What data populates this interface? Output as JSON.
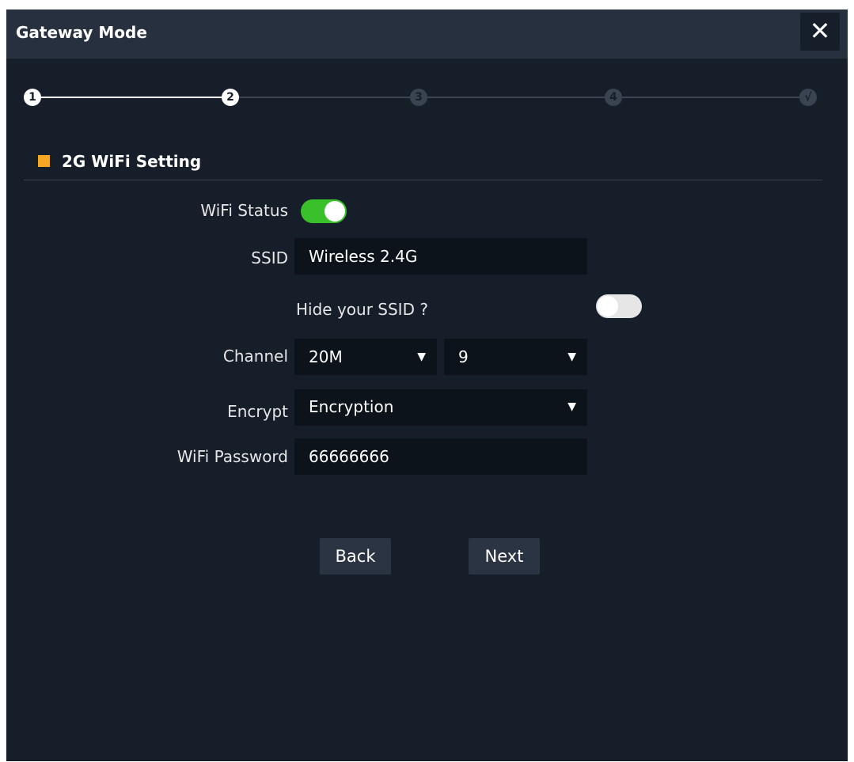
{
  "dialog": {
    "title": "Gateway Mode",
    "close_icon": "close-icon"
  },
  "stepper": {
    "steps": [
      "1",
      "2",
      "3",
      "4",
      "√"
    ],
    "current_step": 2,
    "active_color": "#ffffff",
    "inactive_color": "#3a4451"
  },
  "section": {
    "title": "2G WiFi Setting",
    "accent_color": "#f5a623"
  },
  "form": {
    "wifi_status": {
      "label": "WiFi Status",
      "enabled": true,
      "on_color": "#39c02b"
    },
    "ssid": {
      "label": "SSID",
      "value": "Wireless 2.4G"
    },
    "hide_ssid": {
      "label": "Hide your SSID ?",
      "enabled": false
    },
    "channel": {
      "label": "Channel",
      "bandwidth": "20M",
      "number": "9"
    },
    "encrypt": {
      "label": "Encrypt",
      "value": "Encryption"
    },
    "password": {
      "label": "WiFi Password",
      "value": "66666666"
    },
    "select_arrow": "▼"
  },
  "buttons": {
    "back": "Back",
    "next": "Next"
  }
}
